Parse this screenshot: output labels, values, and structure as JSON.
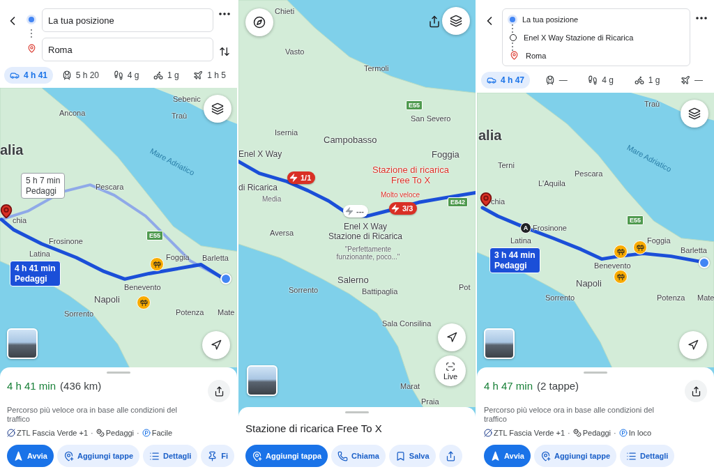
{
  "screens": [
    {
      "kind": "directions",
      "header": {
        "kind": "fields",
        "stops": [
          {
            "kind": "origin",
            "text": "La tua posizione"
          },
          {
            "kind": "destination",
            "text": "Roma"
          }
        ]
      },
      "modes": [
        {
          "kind": "car",
          "label": "4 h 41",
          "selected": true
        },
        {
          "kind": "transit",
          "label": "5 h 20",
          "selected": false
        },
        {
          "kind": "walk",
          "label": "4 g",
          "selected": false
        },
        {
          "kind": "bike",
          "label": "1 g",
          "selected": false
        },
        {
          "kind": "flight",
          "label": "1 h 5",
          "selected": false
        }
      ],
      "map": {
        "labels": [
          {
            "text": "Ancona",
            "kind": "city"
          },
          {
            "text": "Sebenic",
            "kind": "city"
          },
          {
            "text": "Traù",
            "kind": "city"
          },
          {
            "text": "alia",
            "kind": "region"
          },
          {
            "text": "Mare Adriatico",
            "kind": "sea"
          },
          {
            "text": "Pescara",
            "kind": "city"
          },
          {
            "text": "chia",
            "kind": "city"
          },
          {
            "text": "Frosinone",
            "kind": "city"
          },
          {
            "text": "Latina",
            "kind": "city"
          },
          {
            "text": "Foggia",
            "kind": "city"
          },
          {
            "text": "Barletta",
            "kind": "city"
          },
          {
            "text": "Benevento",
            "kind": "city"
          },
          {
            "text": "Napoli",
            "kind": "big-city"
          },
          {
            "text": "Sorrento",
            "kind": "city"
          },
          {
            "text": "Potenza",
            "kind": "city"
          },
          {
            "text": "Mate",
            "kind": "city"
          }
        ],
        "shields": [
          "E55"
        ],
        "callouts": [
          {
            "time": "5 h 7 min",
            "note": "Pedaggi",
            "selected": false
          },
          {
            "time": "4 h 41 min",
            "note": "Pedaggi",
            "selected": true
          }
        ]
      },
      "sheet": {
        "duration": "4 h 41 min",
        "extra": "(436 km)",
        "description": "Percorso più veloce ora in base alle condizioni del traffico",
        "separator": "·",
        "features": [
          {
            "kind": "zone",
            "text": "ZTL Fascia Verde +1"
          },
          {
            "kind": "toll",
            "text": "Pedaggi"
          },
          {
            "kind": "parking",
            "text": "Facile"
          }
        ],
        "actions": [
          {
            "kind": "start",
            "label": "Avvia",
            "primary": true
          },
          {
            "kind": "add-stops",
            "label": "Aggiungi tappe",
            "primary": false
          },
          {
            "kind": "details",
            "label": "Dettagli",
            "primary": false
          },
          {
            "kind": "pin",
            "label": "Fi",
            "primary": false
          }
        ]
      }
    },
    {
      "kind": "place",
      "map": {
        "labels": [
          {
            "text": "Chieti",
            "kind": "city"
          },
          {
            "text": "Vasto",
            "kind": "city"
          },
          {
            "text": "Termoli",
            "kind": "city"
          },
          {
            "text": "San Severo",
            "kind": "city"
          },
          {
            "text": "Isernia",
            "kind": "city"
          },
          {
            "text": "Campobasso",
            "kind": "big-city"
          },
          {
            "text": "Foggia",
            "kind": "big-city"
          },
          {
            "text": "Enel X Way",
            "kind": "place"
          },
          {
            "text": "Stazione di ricarica Free To X",
            "kind": "station"
          },
          {
            "text": "di Ricarica",
            "kind": "place"
          },
          {
            "text": "Media",
            "kind": "review"
          },
          {
            "text": "Molto veloce",
            "kind": "station-note"
          },
          {
            "text": "Aversa",
            "kind": "city"
          },
          {
            "text": "Enel X Way Stazione di Ricarica",
            "kind": "place"
          },
          {
            "text": "\"Perfettamente funzionante, poco...\"",
            "kind": "review"
          },
          {
            "text": "Salerno",
            "kind": "big-city"
          },
          {
            "text": "Pot",
            "kind": "city"
          },
          {
            "text": "Sorrento",
            "kind": "city"
          },
          {
            "text": "Battipaglia",
            "kind": "city"
          },
          {
            "text": "Sala Consilina",
            "kind": "city"
          },
          {
            "text": "Marat",
            "kind": "city"
          },
          {
            "text": "Praia",
            "kind": "city"
          }
        ],
        "shields": [
          "E55",
          "E842"
        ],
        "pins": [
          {
            "label": "1/1",
            "kind": "available"
          },
          {
            "label": "---",
            "kind": "unknown"
          },
          {
            "label": "3/3",
            "kind": "available"
          }
        ],
        "live_label": "Live"
      },
      "sheet": {
        "title": "Stazione di ricarica Free To X",
        "actions": [
          {
            "kind": "add-stop",
            "label": "Aggiungi tappa",
            "primary": true
          },
          {
            "kind": "call",
            "label": "Chiama",
            "primary": false
          },
          {
            "kind": "save",
            "label": "Salva",
            "primary": false
          },
          {
            "kind": "share",
            "primary": false
          }
        ]
      }
    },
    {
      "kind": "directions",
      "header": {
        "kind": "list",
        "stops": [
          {
            "kind": "origin",
            "text": "La tua posizione"
          },
          {
            "kind": "waypoint",
            "text": "Enel X Way Stazione di Ricarica"
          },
          {
            "kind": "destination",
            "text": "Roma"
          }
        ]
      },
      "modes": [
        {
          "kind": "car",
          "label": "4 h 47",
          "selected": true
        },
        {
          "kind": "transit",
          "label": "—",
          "selected": false
        },
        {
          "kind": "walk",
          "label": "4 g",
          "selected": false
        },
        {
          "kind": "bike",
          "label": "1 g",
          "selected": false
        },
        {
          "kind": "flight",
          "label": "—",
          "selected": false
        }
      ],
      "map": {
        "labels": [
          {
            "text": "Traù",
            "kind": "city"
          },
          {
            "text": "alia",
            "kind": "region"
          },
          {
            "text": "Mare Adriatico",
            "kind": "sea"
          },
          {
            "text": "Terni",
            "kind": "city"
          },
          {
            "text": "Pescara",
            "kind": "city"
          },
          {
            "text": "L'Aquila",
            "kind": "city"
          },
          {
            "text": "chia",
            "kind": "city"
          },
          {
            "text": "Frosinone",
            "kind": "city"
          },
          {
            "text": "Latina",
            "kind": "city"
          },
          {
            "text": "Foggia",
            "kind": "city"
          },
          {
            "text": "Barletta",
            "kind": "city"
          },
          {
            "text": "Benevento",
            "kind": "city"
          },
          {
            "text": "Napoli",
            "kind": "big-city"
          },
          {
            "text": "Sorrento",
            "kind": "city"
          },
          {
            "text": "Potenza",
            "kind": "city"
          },
          {
            "text": "Mate",
            "kind": "city"
          }
        ],
        "shields": [
          "E55"
        ],
        "waypoint_marker": "A",
        "callouts": [
          {
            "time": "3 h 44 min",
            "note": "Pedaggi",
            "selected": true
          }
        ]
      },
      "sheet": {
        "duration": "4 h 47 min",
        "extra": "(2 tappe)",
        "description": "Percorso più veloce ora in base alle condizioni del traffico",
        "separator": "·",
        "features": [
          {
            "kind": "zone",
            "text": "ZTL Fascia Verde +1"
          },
          {
            "kind": "toll",
            "text": "Pedaggi"
          },
          {
            "kind": "parking",
            "text": "In loco"
          }
        ],
        "actions": [
          {
            "kind": "start",
            "label": "Avvia",
            "primary": true
          },
          {
            "kind": "add-stops",
            "label": "Aggiungi tappe",
            "primary": false
          },
          {
            "kind": "details",
            "label": "Dettagli",
            "primary": false
          }
        ]
      }
    }
  ]
}
